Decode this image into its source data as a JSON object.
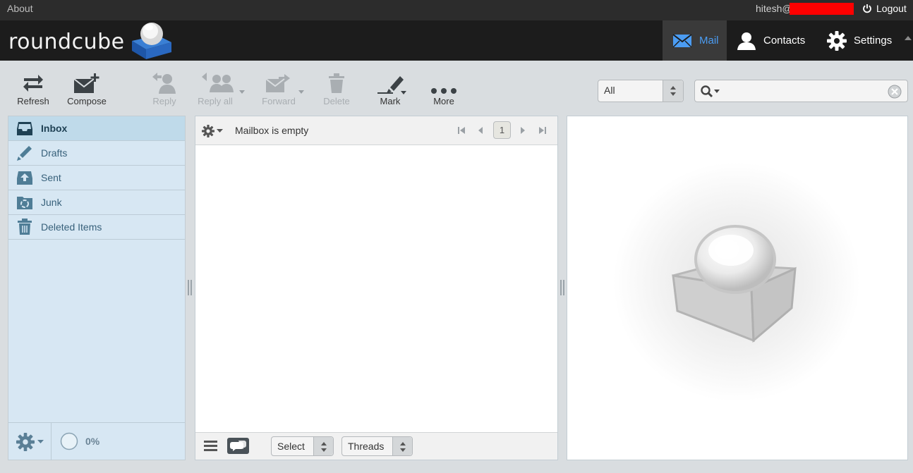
{
  "topline": {
    "about": "About",
    "user": "hitesh@",
    "logout": "Logout"
  },
  "header": {
    "logo": "roundcube",
    "nav": [
      {
        "label": "Mail",
        "icon": "mail-icon",
        "active": true
      },
      {
        "label": "Contacts",
        "icon": "contacts-icon"
      },
      {
        "label": "Settings",
        "icon": "settings-icon"
      }
    ]
  },
  "toolbar": {
    "refresh": "Refresh",
    "compose": "Compose",
    "reply": "Reply",
    "reply_all": "Reply all",
    "forward": "Forward",
    "delete": "Delete",
    "mark": "Mark",
    "more": "More"
  },
  "filter": {
    "value": "All"
  },
  "search": {
    "placeholder": ""
  },
  "folders": [
    {
      "label": "Inbox",
      "icon": "inbox-icon",
      "selected": true
    },
    {
      "label": "Drafts",
      "icon": "drafts-icon"
    },
    {
      "label": "Sent",
      "icon": "sent-icon"
    },
    {
      "label": "Junk",
      "icon": "junk-icon"
    },
    {
      "label": "Deleted Items",
      "icon": "trash-icon"
    }
  ],
  "quota": "0%",
  "message_list": {
    "status": "Mailbox is empty",
    "page": "1",
    "select": "Select",
    "threads": "Threads"
  },
  "colors": {
    "accent": "#4b9cf2",
    "header_bg": "#1c1c1c",
    "folder_bg": "#d7e7f3",
    "redaction": "#ff0000"
  }
}
